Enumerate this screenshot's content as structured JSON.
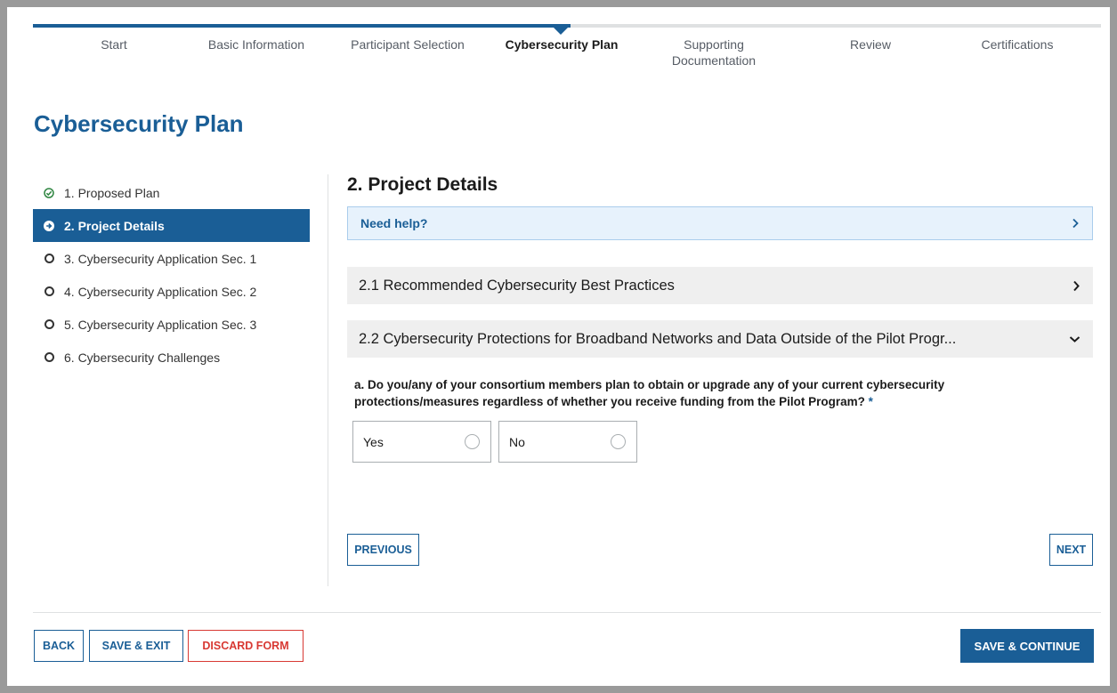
{
  "steps": [
    {
      "label": "Start",
      "state": "complete"
    },
    {
      "label": "Basic Information",
      "state": "complete"
    },
    {
      "label": "Participant Selection",
      "state": "complete"
    },
    {
      "label": "Cybersecurity Plan",
      "state": "current"
    },
    {
      "label": "Supporting Documentation",
      "state": "upcoming"
    },
    {
      "label": "Review",
      "state": "upcoming"
    },
    {
      "label": "Certifications",
      "state": "upcoming"
    }
  ],
  "page_title": "Cybersecurity Plan",
  "sidenav": [
    {
      "label": "1. Proposed Plan",
      "status": "complete",
      "icon": "check-circle-icon"
    },
    {
      "label": "2. Project Details",
      "status": "current",
      "icon": "arrow-circle-right-icon"
    },
    {
      "label": "3. Cybersecurity Application Sec. 1",
      "status": "incomplete",
      "icon": "empty-circle-icon"
    },
    {
      "label": "4. Cybersecurity Application Sec. 2",
      "status": "incomplete",
      "icon": "empty-circle-icon"
    },
    {
      "label": "5. Cybersecurity Application Sec. 3",
      "status": "incomplete",
      "icon": "empty-circle-icon"
    },
    {
      "label": "6. Cybersecurity Challenges",
      "status": "incomplete",
      "icon": "empty-circle-icon"
    }
  ],
  "main": {
    "section_title": "2. Project Details",
    "help_label": "Need help?",
    "accordions": [
      {
        "label": "2.1 Recommended Cybersecurity Best Practices",
        "expanded": false
      },
      {
        "label": "2.2 Cybersecurity Protections for Broadband Networks and Data Outside of the Pilot Progr...",
        "expanded": true
      }
    ],
    "question": "a. Do you/any of your consortium members plan to obtain or upgrade any of your current cybersecurity protections/measures regardless of whether you receive funding from the Pilot Program?",
    "required_mark": "*",
    "options": [
      "Yes",
      "No"
    ],
    "previous_label": "PREVIOUS",
    "next_label": "NEXT"
  },
  "footer": {
    "back_label": "BACK",
    "save_exit_label": "SAVE & EXIT",
    "discard_label": "DISCARD FORM",
    "save_continue_label": "SAVE & CONTINUE"
  },
  "colors": {
    "primary": "#1a5e96",
    "success": "#2e8540",
    "danger": "#d83933",
    "help_bg": "#e7f2fc"
  }
}
